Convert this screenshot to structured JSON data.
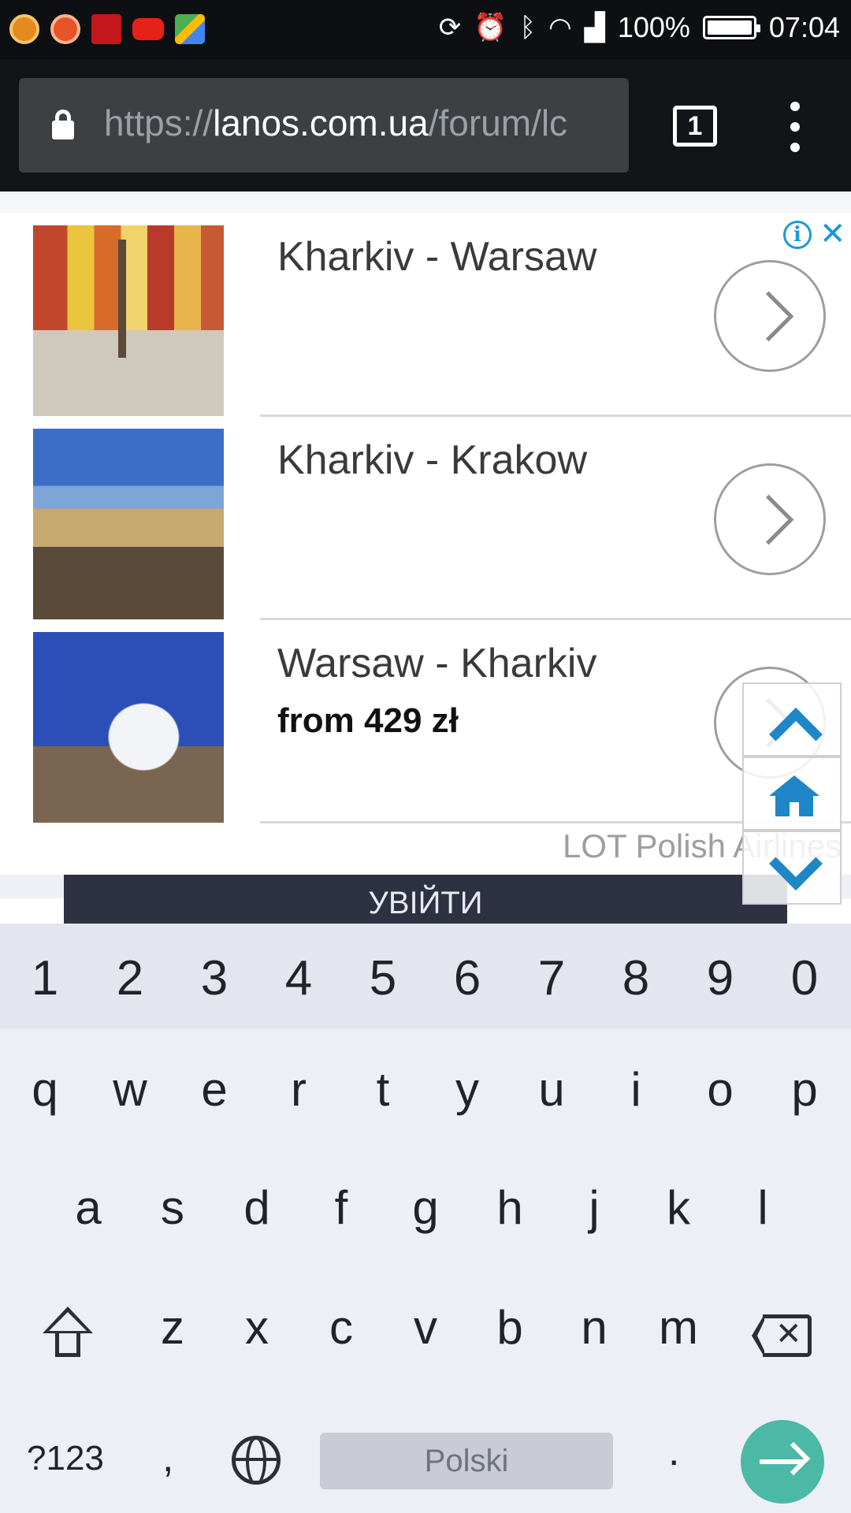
{
  "status_bar": {
    "battery": "100%",
    "time": "07:04",
    "icons": [
      "rotate-icon",
      "alarm-icon",
      "bluetooth-icon",
      "wifi-icon",
      "signal-icon",
      "battery-icon"
    ],
    "notification_apps": [
      "app-notification-1",
      "app-notification-2",
      "app-notification-3",
      "youtube-icon",
      "maps-icon"
    ]
  },
  "browser": {
    "url_scheme": "https://",
    "url_host": "lanos.com.ua",
    "url_path": "/forum/lc",
    "tab_count": "1"
  },
  "ad": {
    "items": [
      {
        "title": "Kharkiv - Warsaw",
        "price": ""
      },
      {
        "title": "Kharkiv - Krakow",
        "price": ""
      },
      {
        "title": "Warsaw - Kharkiv",
        "price": "from 429 zł"
      }
    ],
    "advertiser": "LOT Polish Airlines",
    "info_icon": "i",
    "close_icon": "✕",
    "accent_color": "#1a9ad6"
  },
  "page": {
    "login_button": "УВІЙТИ"
  },
  "keyboard": {
    "numbers": [
      "1",
      "2",
      "3",
      "4",
      "5",
      "6",
      "7",
      "8",
      "9",
      "0"
    ],
    "row1": [
      "q",
      "w",
      "e",
      "r",
      "t",
      "y",
      "u",
      "i",
      "o",
      "p"
    ],
    "row2": [
      "a",
      "s",
      "d",
      "f",
      "g",
      "h",
      "j",
      "k",
      "l"
    ],
    "row3": [
      "z",
      "x",
      "c",
      "v",
      "b",
      "n",
      "m"
    ],
    "symbols_key": "?123",
    "comma_key": ",",
    "space_label": "Polski",
    "period_key": ".",
    "enter_color": "#4cb8a6"
  }
}
